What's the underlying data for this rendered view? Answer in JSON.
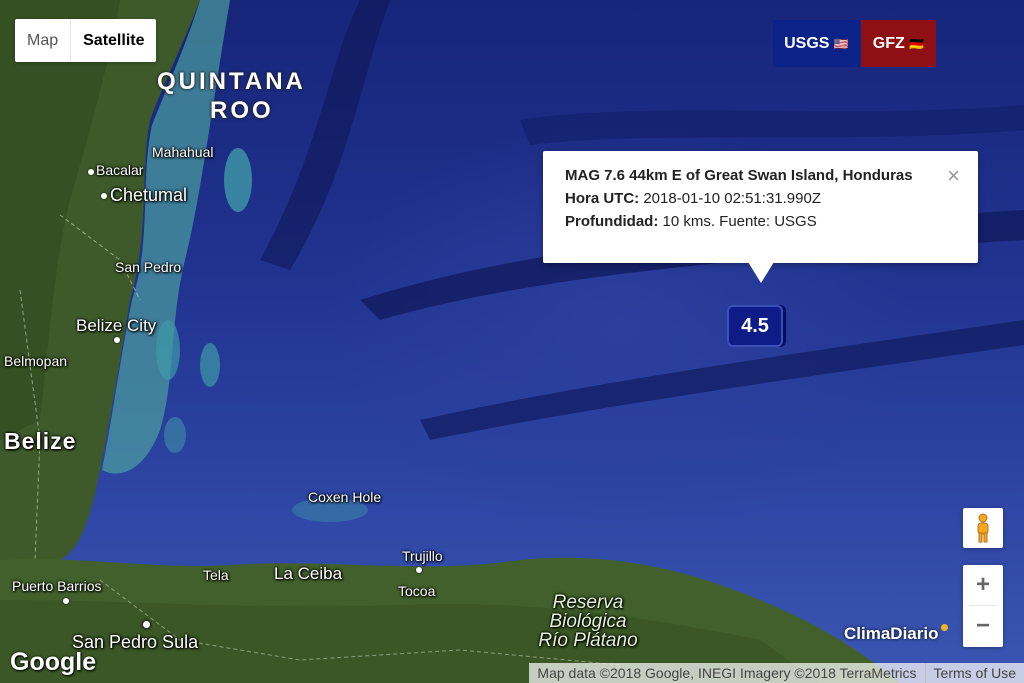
{
  "map_type": {
    "map_label": "Map",
    "satellite_label": "Satellite",
    "selected": "Satellite"
  },
  "sources": {
    "usgs_label": "USGS",
    "usgs_flag": "🇺🇸",
    "gfz_label": "GFZ",
    "gfz_flag": "🇩🇪",
    "usgs_color": "#0b2289",
    "gfz_color": "#8e0f14"
  },
  "info_window": {
    "title": "MAG 7.6 44km E of Great Swan Island, Honduras",
    "time_label": "Hora UTC:",
    "time_value": "2018-01-10 02:51:31.990Z",
    "depth_label": "Profundidad:",
    "depth_value": "10 kms. Fuente: USGS",
    "close_icon": "×"
  },
  "marker": {
    "label": "4.5"
  },
  "places": {
    "quintana": "QUINTANA",
    "roo": "ROO",
    "mahahual": "Mahahual",
    "bacalar": "Bacalar",
    "chetumal": "Chetumal",
    "san_pedro": "San Pedro",
    "belize_city": "Belize City",
    "belmopan": "Belmopan",
    "belize": "Belize",
    "coxen_hole": "Coxen Hole",
    "trujillo": "Trujillo",
    "tela": "Tela",
    "la_ceiba": "La Ceiba",
    "tocoa": "Tocoa",
    "puerto_barrios": "Puerto Barrios",
    "san_pedro_sula": "San Pedro Sula",
    "reserva_1": "Reserva",
    "reserva_2": "Biológica",
    "reserva_3": "Río Plátano"
  },
  "controls": {
    "zoom_in": "+",
    "zoom_out": "−",
    "pegman_icon": "pegman-icon"
  },
  "branding": {
    "climadiario": "ClimaDiario",
    "google": "Google"
  },
  "attribution": {
    "data": "Map data ©2018 Google, INEGI Imagery ©2018 TerraMetrics",
    "terms": "Terms of Use"
  }
}
